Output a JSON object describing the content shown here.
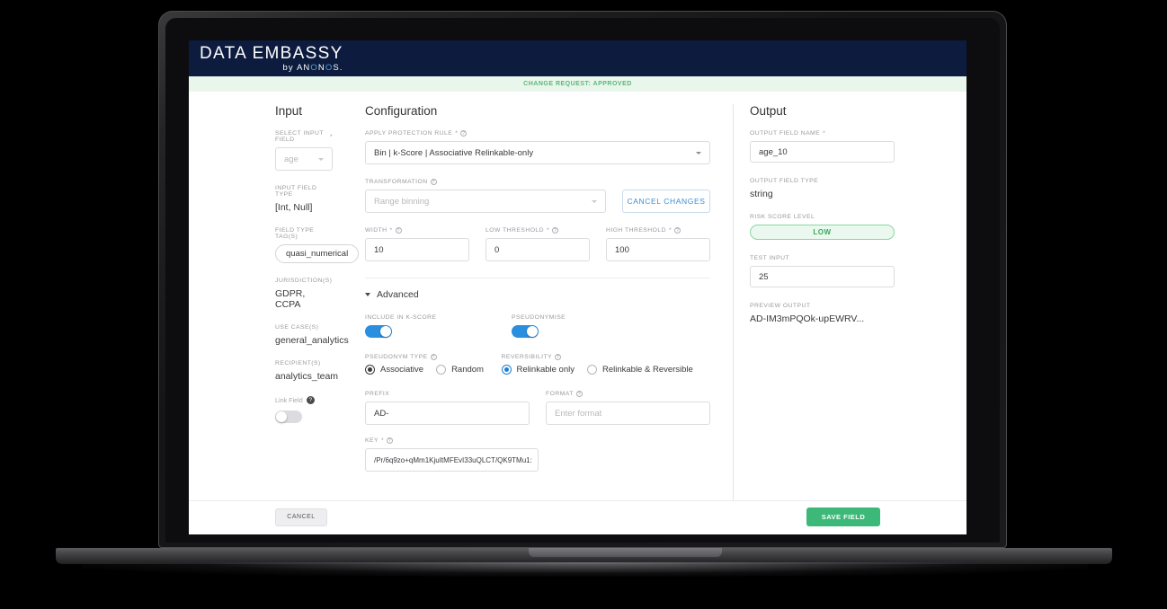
{
  "brand": {
    "name": "DATA EMBASSY",
    "by_prefix": "by AN",
    "by_o1": "O",
    "by_mid": "N",
    "by_o2": "O",
    "by_suffix": "S.",
    "by_full": "by ANONOS.",
    "topbar_color": "#0d1b3e"
  },
  "status": {
    "text": "CHANGE REQUEST: APPROVED",
    "color": "#5cb878",
    "background": "#e8f6ec"
  },
  "input_panel": {
    "title": "Input",
    "select_input_field": {
      "label": "SELECT INPUT FIELD",
      "required": "*",
      "value": "age"
    },
    "input_field_type": {
      "label": "INPUT FIELD TYPE",
      "value": "[Int, Null]"
    },
    "field_type_tags": {
      "label": "FIELD TYPE TAG(S)",
      "value": "quasi_numerical"
    },
    "jurisdictions": {
      "label": "JURISDICTION(S)",
      "value": "GDPR, CCPA"
    },
    "use_cases": {
      "label": "USE CASE(S)",
      "value": "general_analytics"
    },
    "recipients": {
      "label": "RECIPIENT(S)",
      "value": "analytics_team"
    },
    "link_field": {
      "label": "Link Field",
      "help": "?",
      "state": "off"
    }
  },
  "config_panel": {
    "title": "Configuration",
    "apply_protection_rule": {
      "label": "APPLY PROTECTION RULE",
      "required": "*",
      "help": "?",
      "value": "Bin | k-Score | Associative Relinkable-only"
    },
    "transformation": {
      "label": "TRANSFORMATION",
      "help": "?",
      "value": "Range binning"
    },
    "cancel_changes_label": "CANCEL CHANGES",
    "width": {
      "label": "WIDTH",
      "required": "*",
      "help": "?",
      "value": "10"
    },
    "low_threshold": {
      "label": "LOW THRESHOLD",
      "required": "*",
      "help": "?",
      "value": "0"
    },
    "high_threshold": {
      "label": "HIGH THRESHOLD",
      "required": "*",
      "help": "?",
      "value": "100"
    },
    "advanced_label": "Advanced",
    "include_in_kscore": {
      "label": "INCLUDE IN K-SCORE",
      "state": "on"
    },
    "pseudonymise": {
      "label": "PSEUDONYMISE",
      "state": "on"
    },
    "pseudonym_type": {
      "label": "PSEUDONYM TYPE",
      "help": "?",
      "option_1": "Associative",
      "option_2": "Random",
      "selected": "Associative"
    },
    "reversibility": {
      "label": "REVERSIBILITY",
      "help": "?",
      "option_1": "Relinkable only",
      "option_2": "Relinkable & Reversible",
      "selected": "Relinkable only"
    },
    "prefix": {
      "label": "PREFIX",
      "value": "AD-"
    },
    "format": {
      "label": "FORMAT",
      "help": "?",
      "placeholder": "Enter format",
      "value": ""
    },
    "key": {
      "label": "KEY",
      "required": "*",
      "help": "?",
      "value": "/Pr/6q9zo+qMm1KjuItMFEvI33uQLCT/QK9TMu1:"
    }
  },
  "output_panel": {
    "title": "Output",
    "output_field_name": {
      "label": "OUTPUT FIELD NAME",
      "required": "*",
      "value": "age_10"
    },
    "output_field_type": {
      "label": "OUTPUT FIELD TYPE",
      "value": "string"
    },
    "risk_score_level": {
      "label": "RISK SCORE LEVEL",
      "value": "LOW",
      "color": "#3aa85c"
    },
    "test_input": {
      "label": "TEST INPUT",
      "value": "25"
    },
    "preview_output": {
      "label": "PREVIEW OUTPUT",
      "value": "AD-IM3mPQOk-upEWRV..."
    }
  },
  "footer": {
    "cancel_label": "CANCEL",
    "save_label": "SAVE FIELD",
    "save_color": "#3cb878"
  }
}
